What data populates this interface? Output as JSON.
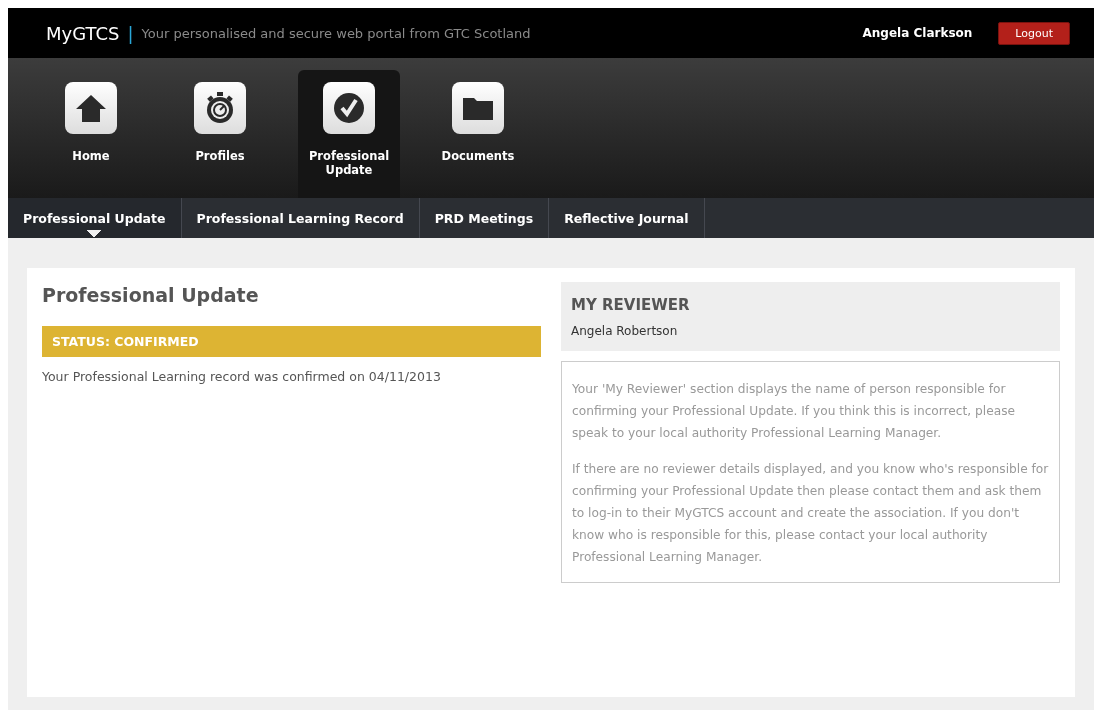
{
  "header": {
    "logo": "MyGTCS",
    "divider": "|",
    "tagline": "Your personalised and secure web portal from GTC Scotland",
    "user": "Angela Clarkson",
    "logout": "Logout"
  },
  "main_nav": [
    {
      "label": "Home",
      "kind": "home",
      "selected": false
    },
    {
      "label": "Profiles",
      "kind": "stopwatch",
      "selected": false
    },
    {
      "label": "Professional Update",
      "kind": "check",
      "selected": true
    },
    {
      "label": "Documents",
      "kind": "folder",
      "selected": false
    }
  ],
  "sub_nav": [
    {
      "label": "Professional Update",
      "selected": true
    },
    {
      "label": "Professional Learning Record",
      "selected": false
    },
    {
      "label": "PRD Meetings",
      "selected": false
    },
    {
      "label": "Reflective Journal",
      "selected": false
    }
  ],
  "content": {
    "title": "Professional Update",
    "status": "STATUS: CONFIRMED",
    "message": "Your Professional Learning record was confirmed on 04/11/2013"
  },
  "reviewer": {
    "heading": "MY REVIEWER",
    "name": "Angela Robertson",
    "paragraphs": [
      "Your 'My Reviewer' section displays the name of person responsible for confirming your Professional Update. If you think this is incorrect, please speak to your local authority Professional Learning Manager.",
      "If there are no reviewer details displayed, and you know who's responsible for confirming your Professional Update then please contact them and ask them to log-in to their MyGTCS account and create the association. If you don't know who is responsible for this, please contact your local authority Professional Learning Manager."
    ]
  }
}
